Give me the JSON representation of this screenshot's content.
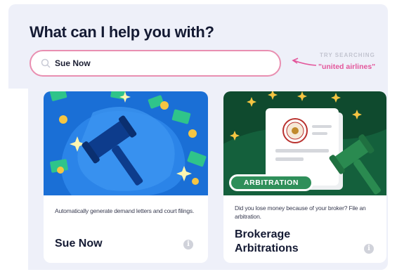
{
  "header": {
    "title": "What can I help you with?"
  },
  "search": {
    "value": "Sue Now"
  },
  "hint": {
    "label": "TRY SEARCHING",
    "example": "\"united airlines\""
  },
  "cards": [
    {
      "description": "Automatically generate demand letters and court filings.",
      "title": "Sue Now",
      "info_glyph": "i"
    },
    {
      "badge": "ARBITRATION",
      "description": "Did you lose money because of your broker? File an arbitration.",
      "title": "Brokerage Arbitrations",
      "info_glyph": "i"
    }
  ],
  "colors": {
    "accent_pink": "#e3569b",
    "search_border": "#e98fb1",
    "card1_bg": "#1a6fd6",
    "card2_bg": "#0f4a2e",
    "panel_bg": "#eef0f9"
  }
}
